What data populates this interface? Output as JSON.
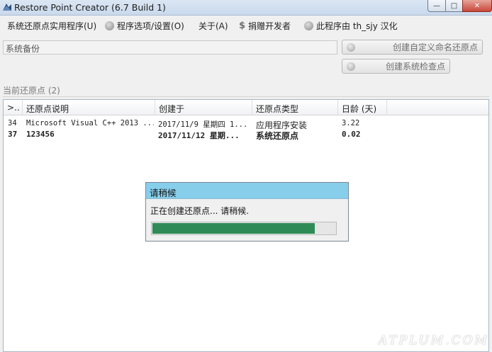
{
  "window": {
    "title": "Restore Point Creator (6.7 Build 1)",
    "controls": {
      "minimize": "—",
      "maximize": "□",
      "close": "✕"
    }
  },
  "menu": {
    "items": [
      {
        "label": "系统还原点实用程序(U)",
        "icon": null
      },
      {
        "label": "程序选项/设置(O)",
        "icon": "settings-icon"
      },
      {
        "label": "关于(A)",
        "icon": null
      },
      {
        "label": "捐赠开发者",
        "icon": "dollar-icon",
        "icon_glyph": "$"
      },
      {
        "label": "此程序由 th_sjy 汉化",
        "icon": "info-icon"
      }
    ]
  },
  "backup": {
    "field_value": "系统备份",
    "create_custom_label": "创建自定义命名还原点",
    "create_check_label": "创建系统检查点"
  },
  "restore_points": {
    "section_label": "当前还原点 (2)",
    "columns": [
      ">..",
      "还原点说明",
      "创建于",
      "还原点类型",
      "日龄 (天)"
    ],
    "rows": [
      {
        "id": "34",
        "description": "Microsoft Visual C++ 2013 ...",
        "created": "2017/11/9 星期四 1...",
        "type": "应用程序安装",
        "age": "3.22",
        "bold": false
      },
      {
        "id": "37",
        "description": "123456",
        "created": "2017/11/12 星期...",
        "type": "系统还原点",
        "age": "0.02",
        "bold": true
      }
    ]
  },
  "dialog": {
    "title": "请稍候",
    "message": "正在创建还原点... 请稍候.",
    "progress_fraction": 0.88,
    "progress_color": "#2e8b57"
  },
  "watermark": "ATPLUM.COM"
}
